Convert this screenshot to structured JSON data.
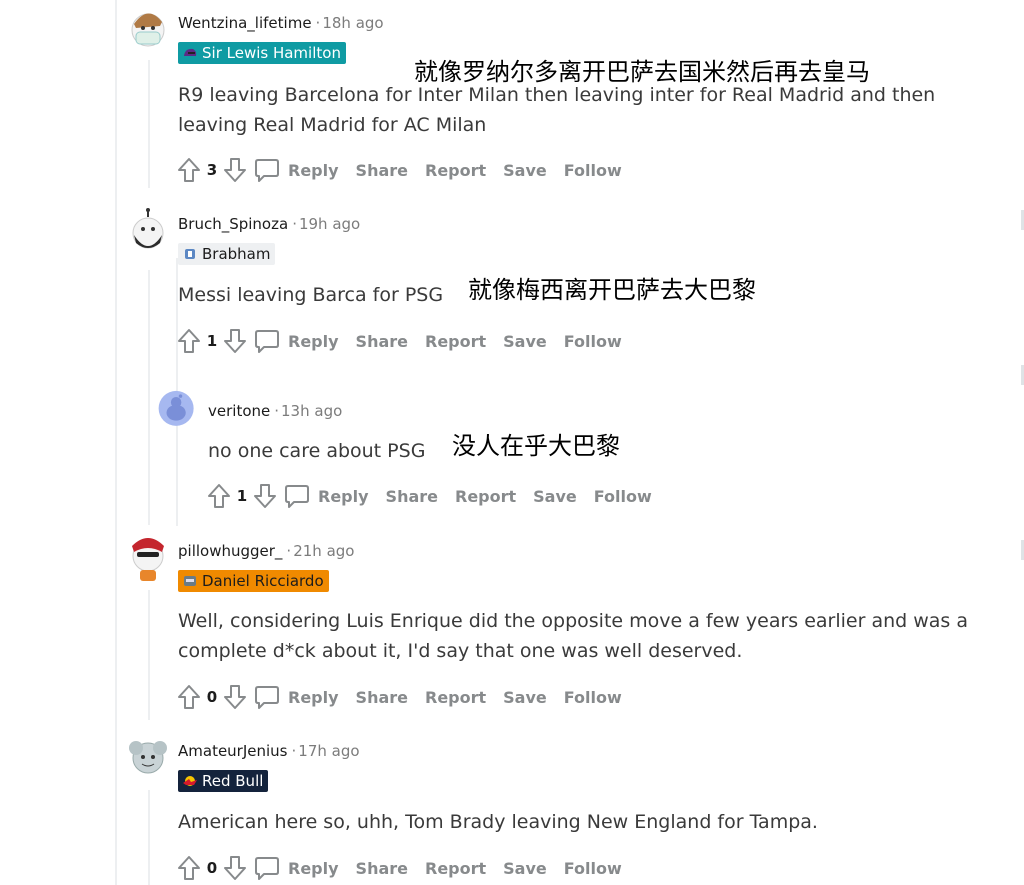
{
  "comments": [
    {
      "username": "Wentzina_lifetime",
      "time": "18h ago",
      "flair": "Sir Lewis Hamilton",
      "body": "R9 leaving Barcelona for Inter Milan then leaving inter for Real Madrid and then leaving Real Madrid for AC Milan",
      "translation": "就像罗纳尔多离开巴萨去国米然后再去皇马",
      "votes": "3"
    },
    {
      "username": "Bruch_Spinoza",
      "time": "19h ago",
      "flair": "Brabham",
      "body": "Messi leaving Barca for PSG",
      "translation": "就像梅西离开巴萨去大巴黎",
      "votes": "1"
    },
    {
      "username": "veritone",
      "time": "13h ago",
      "flair": "",
      "body": "no one care about PSG",
      "translation": "没人在乎大巴黎",
      "votes": "1"
    },
    {
      "username": "pillowhugger_",
      "time": "21h ago",
      "flair": "Daniel Ricciardo",
      "body": "Well, considering Luis Enrique did the opposite move a few years earlier and was a complete d*ck about it, I'd say that one was well deserved.",
      "translation": "",
      "votes": "0"
    },
    {
      "username": "AmateurJenius",
      "time": "17h ago",
      "flair": "Red Bull",
      "body": "American here so, uhh, Tom Brady leaving New England for Tampa.",
      "translation": "",
      "votes": "0"
    }
  ],
  "actions": {
    "reply": "Reply",
    "share": "Share",
    "report": "Report",
    "save": "Save",
    "follow": "Follow"
  },
  "separator": "·",
  "colors": {
    "flair_teal": "#0f9ba3",
    "flair_orange": "#f08a00",
    "flair_navy": "#14233c",
    "flair_grey": "#eef0f2",
    "meta_grey": "#7c7c7c",
    "action_grey": "#878a8c",
    "thread_line": "#edeff1"
  },
  "icons": [
    "upvote-arrow-icon",
    "downvote-arrow-icon",
    "reply-bubble-icon",
    "snoo-avatar-icon",
    "helmet-flair-icon",
    "car-flair-icon",
    "bull-flair-icon"
  ]
}
